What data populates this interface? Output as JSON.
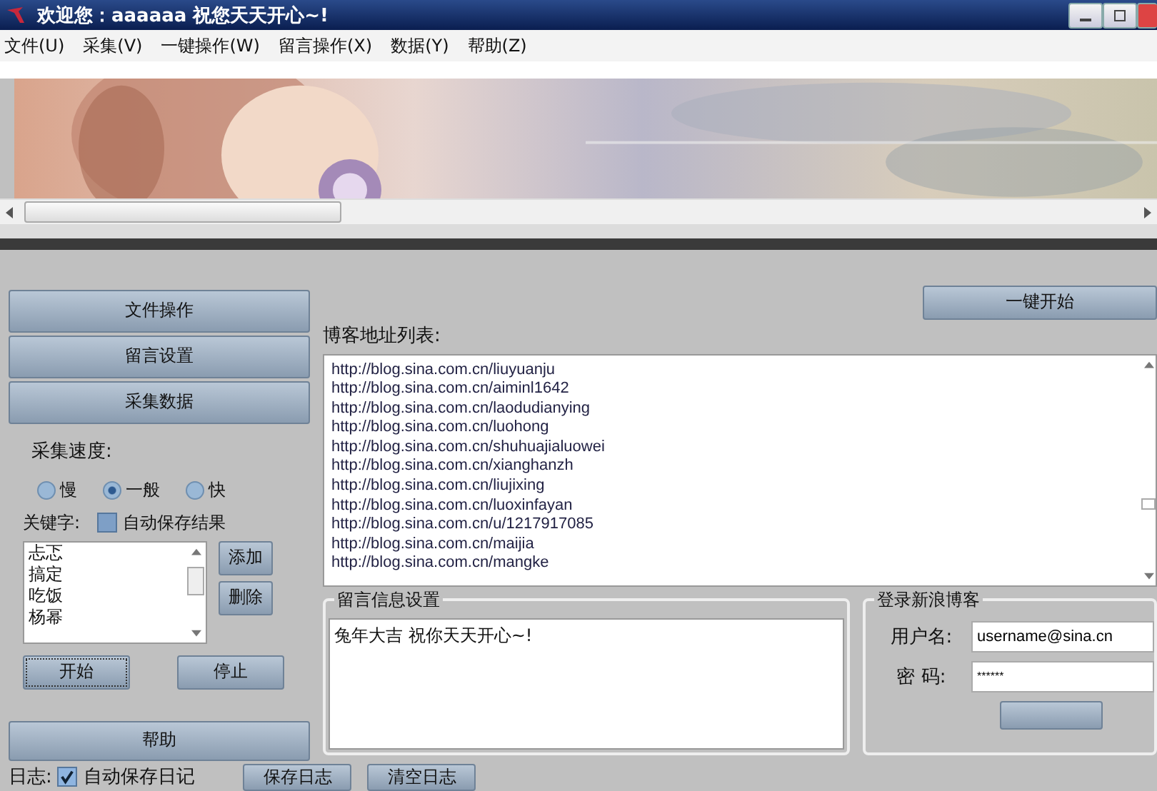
{
  "window": {
    "title": "欢迎您：aaaaaa 祝您天天开心~!"
  },
  "menu": [
    "文件(U)",
    "采集(V)",
    "一键操作(W)",
    "留言操作(X)",
    "数据(Y)",
    "帮助(Z)"
  ],
  "sidebar": {
    "sections": [
      {
        "label": "文件操作"
      },
      {
        "label": "留言设置"
      },
      {
        "label": "采集数据"
      }
    ],
    "speed_label": "采集速度:",
    "speeds": [
      {
        "label": "慢",
        "selected": false
      },
      {
        "label": "一般",
        "selected": true
      },
      {
        "label": "快",
        "selected": false
      }
    ],
    "keyword_label": "关键字:",
    "auto_save_results": {
      "label": "自动保存结果",
      "checked": false
    },
    "keywords": [
      "忐忑",
      "搞定",
      "吃饭",
      "杨幂"
    ],
    "add_button": "添加",
    "delete_button": "删除",
    "start_button": "开始",
    "stop_button": "停止",
    "help_button": "帮助"
  },
  "one_click_button": "一键开始",
  "blog_list": {
    "label": "博客地址列表:",
    "items": [
      "http://blog.sina.com.cn/liuyuanju",
      "http://blog.sina.com.cn/aiminl1642",
      "http://blog.sina.com.cn/laodudianying",
      "http://blog.sina.com.cn/luohong",
      "http://blog.sina.com.cn/shuhuajialuowei",
      "http://blog.sina.com.cn/xianghanzh",
      "http://blog.sina.com.cn/liujixing",
      "http://blog.sina.com.cn/luoxinfayan",
      "http://blog.sina.com.cn/u/1217917085",
      "http://blog.sina.com.cn/maijia",
      "http://blog.sina.com.cn/mangke"
    ]
  },
  "message_settings": {
    "title": "留言信息设置",
    "text": "兔年大吉 祝你天天开心~!"
  },
  "login": {
    "title": "登录新浪博客",
    "username_label": "用户名:",
    "username": "username@sina.cn",
    "password_label": "密  码:",
    "password": "******"
  },
  "log": {
    "label": "日志:",
    "auto_save": {
      "label": "自动保存日记",
      "checked": true
    },
    "save_button": "保存日志",
    "clear_button": "清空日志"
  }
}
